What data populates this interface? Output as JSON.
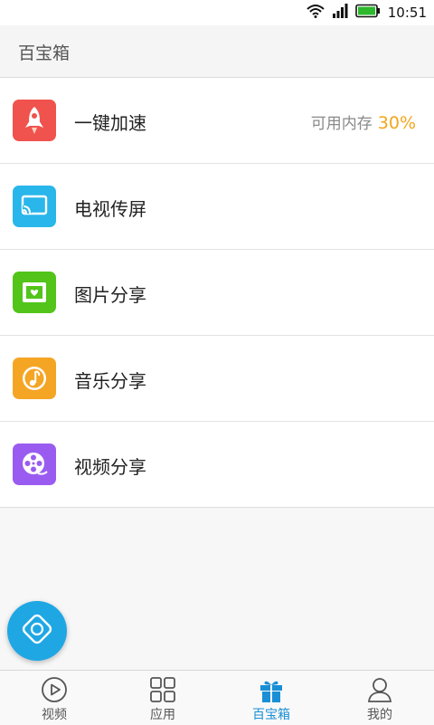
{
  "status_bar": {
    "time": "10:51"
  },
  "header": {
    "title": "百宝箱"
  },
  "colors": {
    "accent": "#1a8fd6",
    "percent": "#f4a51c",
    "speed_icon_bg": "#f0534d",
    "tv_icon_bg": "#29b6ea",
    "photo_icon_bg": "#52c41a",
    "music_icon_bg": "#f5a524",
    "video_icon_bg": "#9a5cf0"
  },
  "items": [
    {
      "label": "一键加速",
      "icon": "rocket-icon",
      "right_label": "可用内存",
      "right_value": "30%"
    },
    {
      "label": "电视传屏",
      "icon": "cast-icon"
    },
    {
      "label": "图片分享",
      "icon": "picture-icon"
    },
    {
      "label": "音乐分享",
      "icon": "music-note-icon"
    },
    {
      "label": "视频分享",
      "icon": "film-reel-icon"
    }
  ],
  "fab": {
    "icon": "remote-control-icon"
  },
  "tabs": [
    {
      "label": "视频",
      "icon": "play-circle-icon",
      "active": false
    },
    {
      "label": "应用",
      "icon": "grid-icon",
      "active": false
    },
    {
      "label": "百宝箱",
      "icon": "gift-icon",
      "active": true
    },
    {
      "label": "我的",
      "icon": "user-icon",
      "active": false
    }
  ]
}
